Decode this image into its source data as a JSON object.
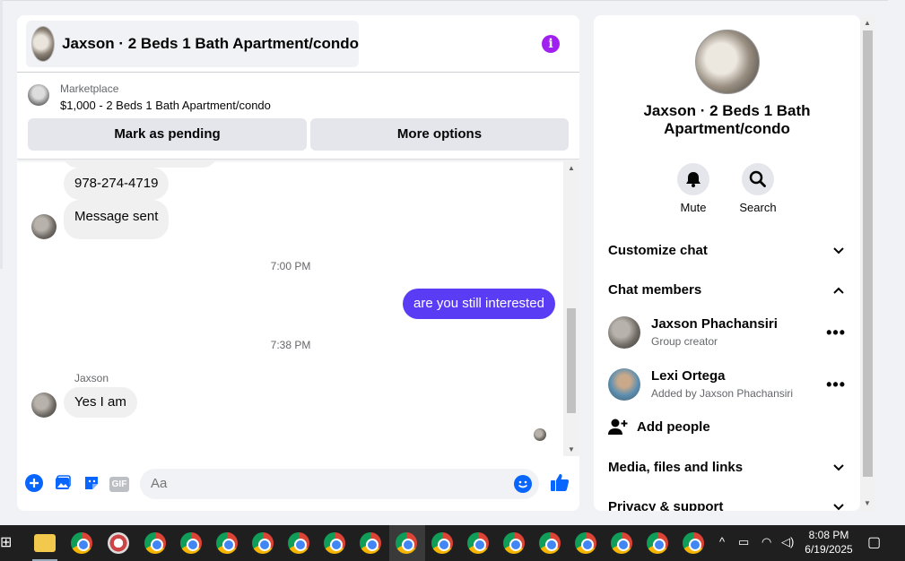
{
  "chat": {
    "title": "Jaxson · 2 Beds 1 Bath Apartment/condo",
    "marketplace_label": "Marketplace",
    "listing": "$1,000 - 2 Beds 1 Bath Apartment/condo",
    "mark_pending": "Mark as pending",
    "more_options": "More options",
    "messages": {
      "phone": "978-274-4719",
      "sent": "Message sent",
      "time1": "7:00 PM",
      "outgoing": "are you still interested",
      "time2": "7:38 PM",
      "sender": "Jaxson",
      "reply": "Yes I am"
    },
    "input_placeholder": "Aa",
    "gif_label": "GIF"
  },
  "side": {
    "name": "Jaxson · 2 Beds 1 Bath Apartment/condo",
    "mute": "Mute",
    "search": "Search",
    "customize": "Customize chat",
    "members_header": "Chat members",
    "members": [
      {
        "name": "Jaxson Phachansiri",
        "sub": "Group creator"
      },
      {
        "name": "Lexi Ortega",
        "sub": "Added by Jaxson Phachansiri"
      }
    ],
    "add_people": "Add people",
    "media": "Media, files and links",
    "privacy": "Privacy & support"
  },
  "taskbar": {
    "time": "8:08 PM",
    "date": "6/19/2025"
  },
  "colors": {
    "accent": "#0866ff",
    "outgoing_bubble": "#5b3cf5",
    "info": "#a020f0"
  }
}
